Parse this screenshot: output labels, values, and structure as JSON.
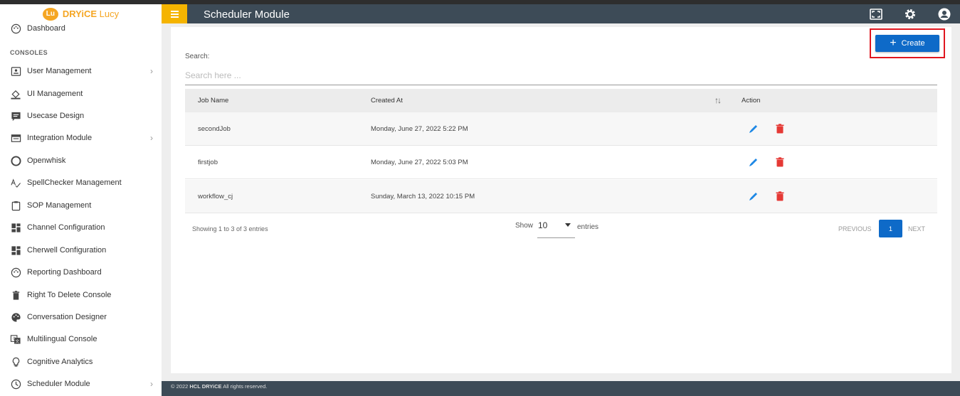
{
  "app": {
    "logo_badge": "Lu",
    "logo_brand": "DRYiCE",
    "logo_product": "Lucy"
  },
  "header": {
    "title": "Scheduler Module",
    "icons": [
      "fullscreen-icon",
      "settings-gear-icon",
      "account-circle-icon"
    ]
  },
  "sidebar": {
    "top_item": {
      "label": "Dashboard",
      "icon": "palette-icon"
    },
    "section_label": "CONSOLES",
    "items": [
      {
        "label": "User Management",
        "icon": "account-box-icon",
        "has_children": true
      },
      {
        "label": "UI Management",
        "icon": "paint-bucket-icon",
        "has_children": false
      },
      {
        "label": "Usecase Design",
        "icon": "message-box-icon",
        "has_children": false
      },
      {
        "label": "Integration Module",
        "icon": "web-window-icon",
        "has_children": true
      },
      {
        "label": "Openwhisk",
        "icon": "cloud-circle-icon",
        "has_children": false
      },
      {
        "label": "SpellChecker Management",
        "icon": "spellcheck-icon",
        "has_children": false
      },
      {
        "label": "SOP Management",
        "icon": "clipboard-icon",
        "has_children": false
      },
      {
        "label": "Channel Configuration",
        "icon": "dashboard-tiles-icon",
        "has_children": false
      },
      {
        "label": "Cherwell Configuration",
        "icon": "dashboard-tiles-icon",
        "has_children": false
      },
      {
        "label": "Reporting Dashboard",
        "icon": "palette-icon",
        "has_children": false
      },
      {
        "label": "Right To Delete Console",
        "icon": "trash-icon",
        "has_children": false
      },
      {
        "label": "Conversation Designer",
        "icon": "palette-filled-icon",
        "has_children": false
      },
      {
        "label": "Multilingual Console",
        "icon": "translate-icon",
        "has_children": false
      },
      {
        "label": "Cognitive Analytics",
        "icon": "lightbulb-icon",
        "has_children": false
      },
      {
        "label": "Scheduler Module",
        "icon": "clock-icon",
        "has_children": true
      }
    ]
  },
  "toolbar": {
    "create_label": "Create"
  },
  "search": {
    "label": "Search:",
    "placeholder": "Search here ...",
    "value": ""
  },
  "table": {
    "columns": [
      "Job Name",
      "Created At",
      "Action"
    ],
    "sort_glyph": "↑↓",
    "rows": [
      {
        "job_name": "secondJob",
        "created_at": "Monday, June 27, 2022 5:22 PM"
      },
      {
        "job_name": "firstjob",
        "created_at": "Monday, June 27, 2022 5:03 PM"
      },
      {
        "job_name": "workflow_cj",
        "created_at": "Sunday, March 13, 2022 10:15 PM"
      }
    ]
  },
  "pagination": {
    "showing_text": "Showing 1 to 3 of 3 entries",
    "show_label": "Show",
    "page_size": "10",
    "entries_label": "entries",
    "previous_label": "PREVIOUS",
    "current_page": "1",
    "next_label": "NEXT"
  },
  "footer": {
    "copyright": "© 2022",
    "brand": "HCL DRYiCE",
    "rights": "All rights reserved."
  },
  "colors": {
    "header_bg": "#3d4b57",
    "accent_yellow": "#f5b400",
    "primary_blue": "#0e6ac8",
    "delete_red": "#e53935",
    "highlight_red": "#e0161f"
  }
}
